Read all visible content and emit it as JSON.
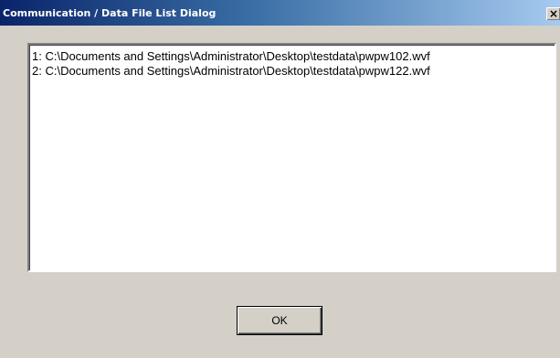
{
  "window": {
    "title": "Communication / Data File List Dialog",
    "close_glyph": "×",
    "close_icon": "close-icon"
  },
  "file_list": {
    "items": [
      "1: C:\\Documents and Settings\\Administrator\\Desktop\\testdata\\pwpw102.wvf",
      "2: C:\\Documents and Settings\\Administrator\\Desktop\\testdata\\pwpw122.wvf"
    ]
  },
  "buttons": {
    "ok_label": "OK"
  },
  "colors": {
    "title_bar_start": "#0a246a",
    "title_bar_end": "#a6caf0",
    "face": "#d4d0c8",
    "list_background": "#ffffff"
  }
}
